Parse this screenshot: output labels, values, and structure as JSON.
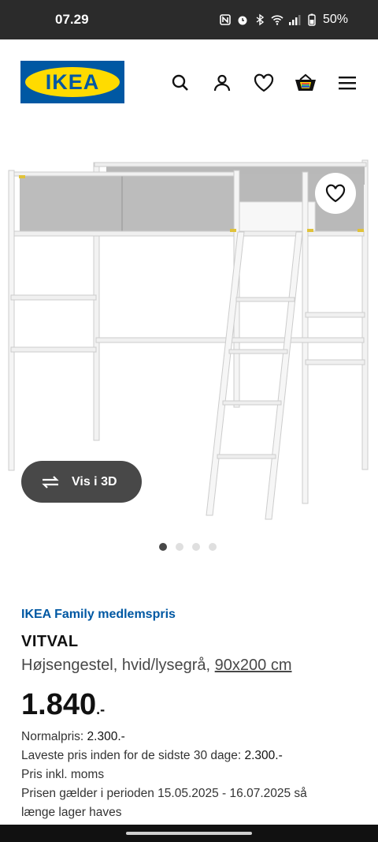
{
  "status_bar": {
    "time": "07.29",
    "battery": "50%"
  },
  "header": {
    "logo_text": "IKEA",
    "icons": [
      "search-icon",
      "profile-icon",
      "wishlist-heart-icon",
      "shopping-bag-icon",
      "menu-icon"
    ]
  },
  "gallery": {
    "view_3d_label": "Vis i 3D",
    "dot_count": 4,
    "active_dot": 1
  },
  "product": {
    "family_price_label": "IKEA Family medlemspris",
    "name": "VITVAL",
    "description": "Højsengestel, hvid/lysegrå,",
    "size": "90x200 cm",
    "price_main": "1.840",
    "price_suffix": ".-",
    "normal_price_label": "Normalpris:",
    "normal_price_value": "2.300.-",
    "lowest_price_label": "Laveste pris inden for de sidste 30 dage:",
    "lowest_price_value": "2.300.-",
    "vat_note": "Pris inkl. moms",
    "validity_line1": "Prisen gælder i perioden 15.05.2025 - 16.07.2025 så",
    "validity_line2": "længe lager haves"
  },
  "colors": {
    "ikea_blue": "#0058a3",
    "ikea_yellow": "#ffdb00",
    "dark_button": "#484848"
  }
}
